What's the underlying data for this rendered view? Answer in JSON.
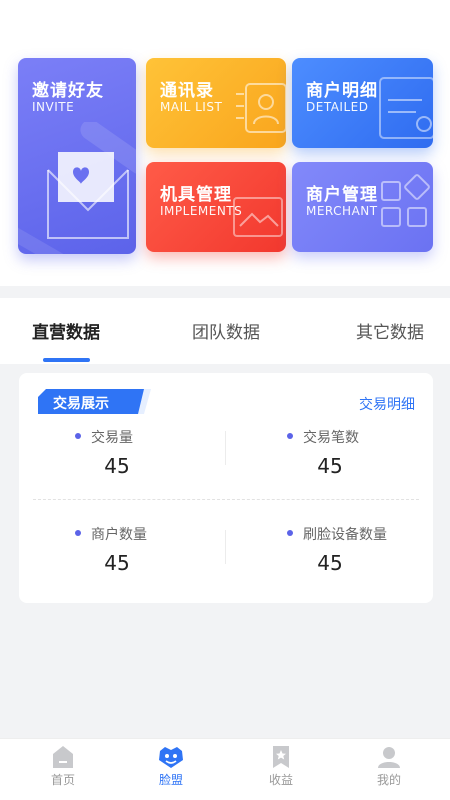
{
  "grid": {
    "invite": {
      "cn": "邀请好友",
      "en": "INVITE"
    },
    "mail": {
      "cn": "通讯录",
      "en": "MAIL LIST"
    },
    "detail": {
      "cn": "商户明细",
      "en": "DETAILED"
    },
    "implements": {
      "cn": "机具管理",
      "en": "IMPLEMENTS"
    },
    "merchant": {
      "cn": "商户管理",
      "en": "MERCHANT"
    }
  },
  "tabs": [
    {
      "label": "直营数据",
      "active": true
    },
    {
      "label": "团队数据",
      "active": false
    },
    {
      "label": "其它数据",
      "active": false
    }
  ],
  "card": {
    "badge": "交易展示",
    "link": "交易明细",
    "stats": [
      {
        "label": "交易量",
        "value": "45"
      },
      {
        "label": "交易笔数",
        "value": "45"
      },
      {
        "label": "商户数量",
        "value": "45"
      },
      {
        "label": "刷脸设备数量",
        "value": "45"
      }
    ]
  },
  "nav": [
    {
      "label": "首页",
      "icon": "home-icon"
    },
    {
      "label": "脸盟",
      "icon": "face-alliance-icon"
    },
    {
      "label": "收益",
      "icon": "income-bookmark-icon"
    },
    {
      "label": "我的",
      "icon": "profile-icon"
    }
  ],
  "colors": {
    "accent": "#2f74f5",
    "dot": "#5b63e8",
    "invite": "#6a70f0",
    "mail": "#fbb429",
    "detail": "#3c7cf6",
    "implements": "#f8473b",
    "merchant": "#767df6"
  }
}
